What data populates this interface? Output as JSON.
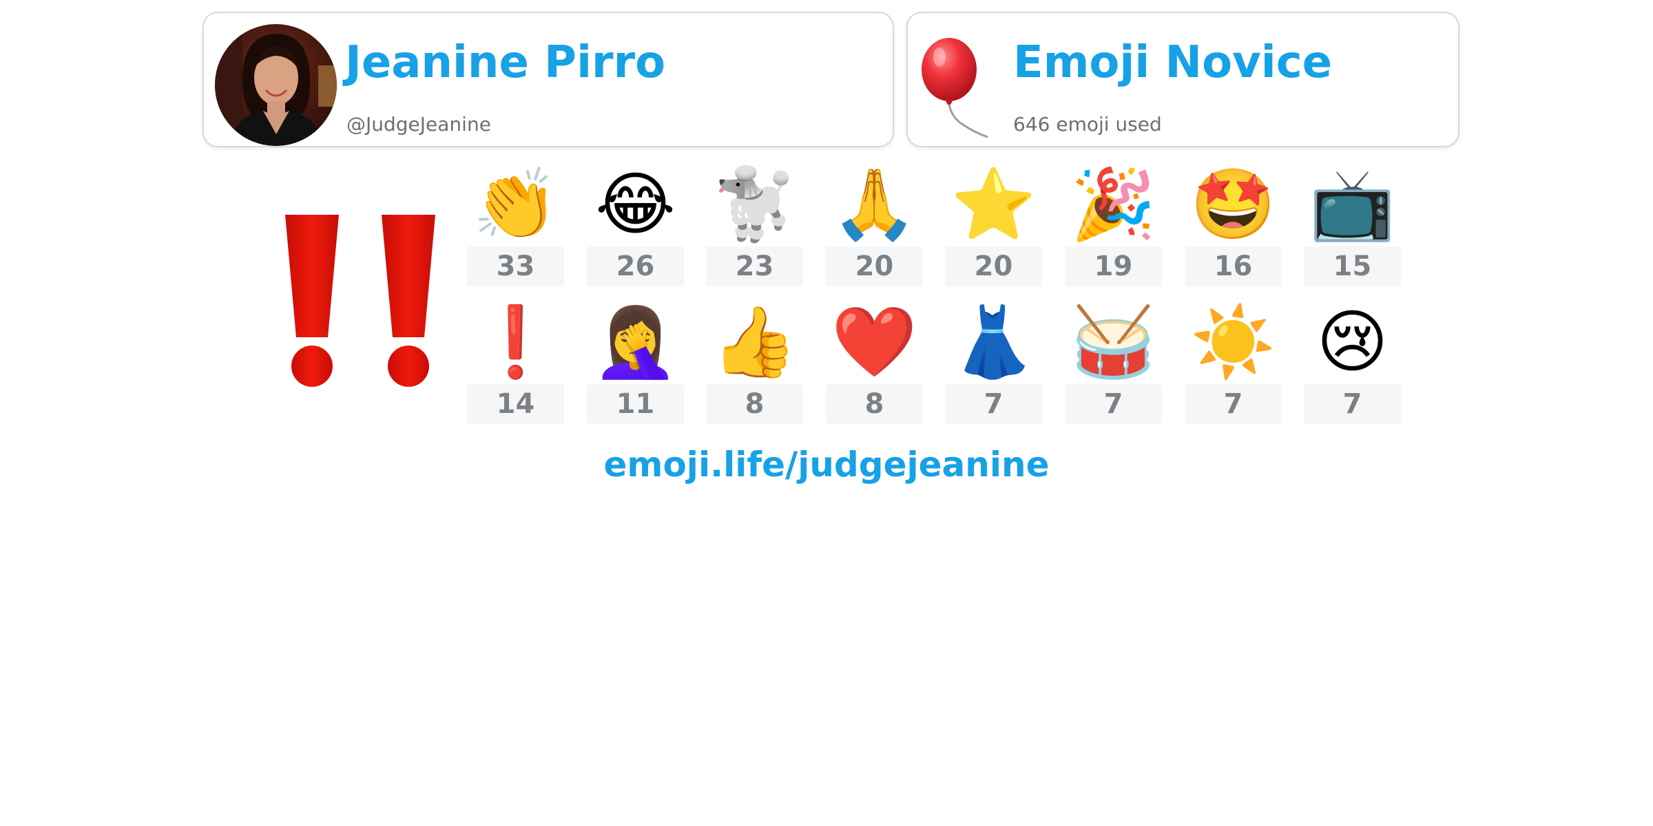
{
  "profile": {
    "name": "Jeanine Pirro",
    "handle": "@JudgeJeanine"
  },
  "rank": {
    "title": "Emoji Novice",
    "subtitle": "646 emoji used",
    "icon": "balloon-icon"
  },
  "hero_emoji": {
    "name": "double-exclamation-icon",
    "color": "#e8150b"
  },
  "top_emoji": [
    {
      "emoji": "👏",
      "icon": "clapping-hands-icon",
      "count": "33"
    },
    {
      "emoji": "😂",
      "icon": "tears-of-joy-icon",
      "count": "26"
    },
    {
      "emoji": "🐩",
      "icon": "poodle-icon",
      "count": "23"
    },
    {
      "emoji": "🙏",
      "icon": "folded-hands-icon",
      "count": "20"
    },
    {
      "emoji": "⭐",
      "icon": "star-icon",
      "count": "20"
    },
    {
      "emoji": "🎉",
      "icon": "party-popper-icon",
      "count": "19"
    },
    {
      "emoji": "🤩",
      "icon": "star-struck-icon",
      "count": "16"
    },
    {
      "emoji": "📺",
      "icon": "television-icon",
      "count": "15"
    },
    {
      "emoji": "❗",
      "icon": "exclamation-icon",
      "count": "14"
    },
    {
      "emoji": "🤦‍♀️",
      "icon": "woman-facepalming-icon",
      "count": "11"
    },
    {
      "emoji": "👍",
      "icon": "thumbs-up-icon",
      "count": "8"
    },
    {
      "emoji": "❤️",
      "icon": "red-heart-icon",
      "count": "8"
    },
    {
      "emoji": "👗",
      "icon": "dress-icon",
      "count": "7"
    },
    {
      "emoji": "🥁",
      "icon": "drum-icon",
      "count": "7"
    },
    {
      "emoji": "☀️",
      "icon": "sun-icon",
      "count": "7"
    },
    {
      "emoji": "😢",
      "icon": "crying-face-icon",
      "count": "7"
    }
  ],
  "footer": {
    "link_text": "emoji.life/judgejeanine"
  },
  "colors": {
    "accent": "#17a1e6",
    "muted_text": "#6b6f75",
    "count_text": "#7e8184",
    "count_bg": "#f5f6f8",
    "card_border": "#d3d8e6"
  }
}
